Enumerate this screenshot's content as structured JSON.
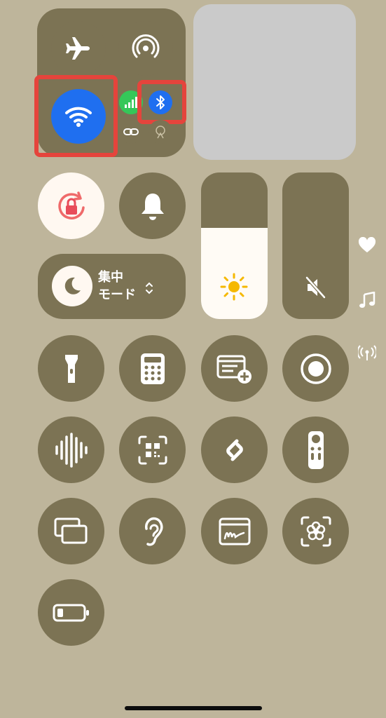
{
  "connectivity": {
    "airplane_icon": "airplane-icon",
    "airdrop_icon": "airdrop-icon",
    "wifi_icon": "wifi-icon",
    "cellular_icon": "cellular-icon",
    "bluetooth_icon": "bluetooth-icon",
    "link_icon": "link-icon",
    "hotspot_icon": "hotspot-icon"
  },
  "focus": {
    "line1": "集中",
    "line2": "モード"
  },
  "brightness": {
    "level": 0.62,
    "icon": "sun-icon"
  },
  "volume": {
    "level": 0.0,
    "icon": "speaker-muted-icon"
  },
  "side_icons": [
    "heart-icon",
    "music-note-icon",
    "antenna-icon"
  ],
  "colors": {
    "background": "#beb59b",
    "tile": "#7c7354",
    "accent_blue": "#1f6ff0",
    "highlight_red": "#e5443c",
    "cellular_green": "#35c759",
    "lock_red": "#ef6a6a"
  }
}
